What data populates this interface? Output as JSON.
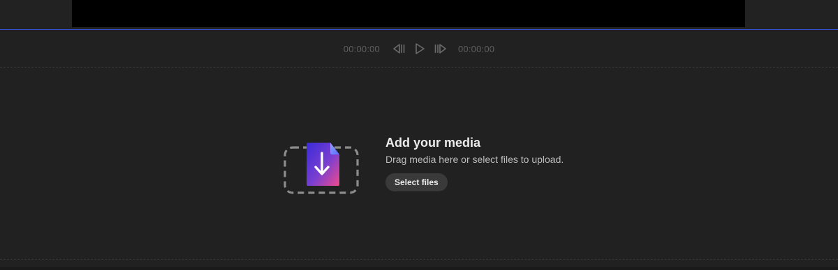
{
  "transport": {
    "current_time": "00:00:00",
    "total_time": "00:00:00",
    "icons": [
      "step-back-icon",
      "play-icon",
      "step-forward-icon"
    ]
  },
  "upload": {
    "icon": "file-download-icon",
    "title": "Add your media",
    "subtitle": "Drag media here or select files to upload.",
    "button_label": "Select files"
  },
  "colors": {
    "background": "#212121",
    "preview": "#000000",
    "playhead": "#3b4fd6",
    "button_bg": "#3a3a3a"
  }
}
